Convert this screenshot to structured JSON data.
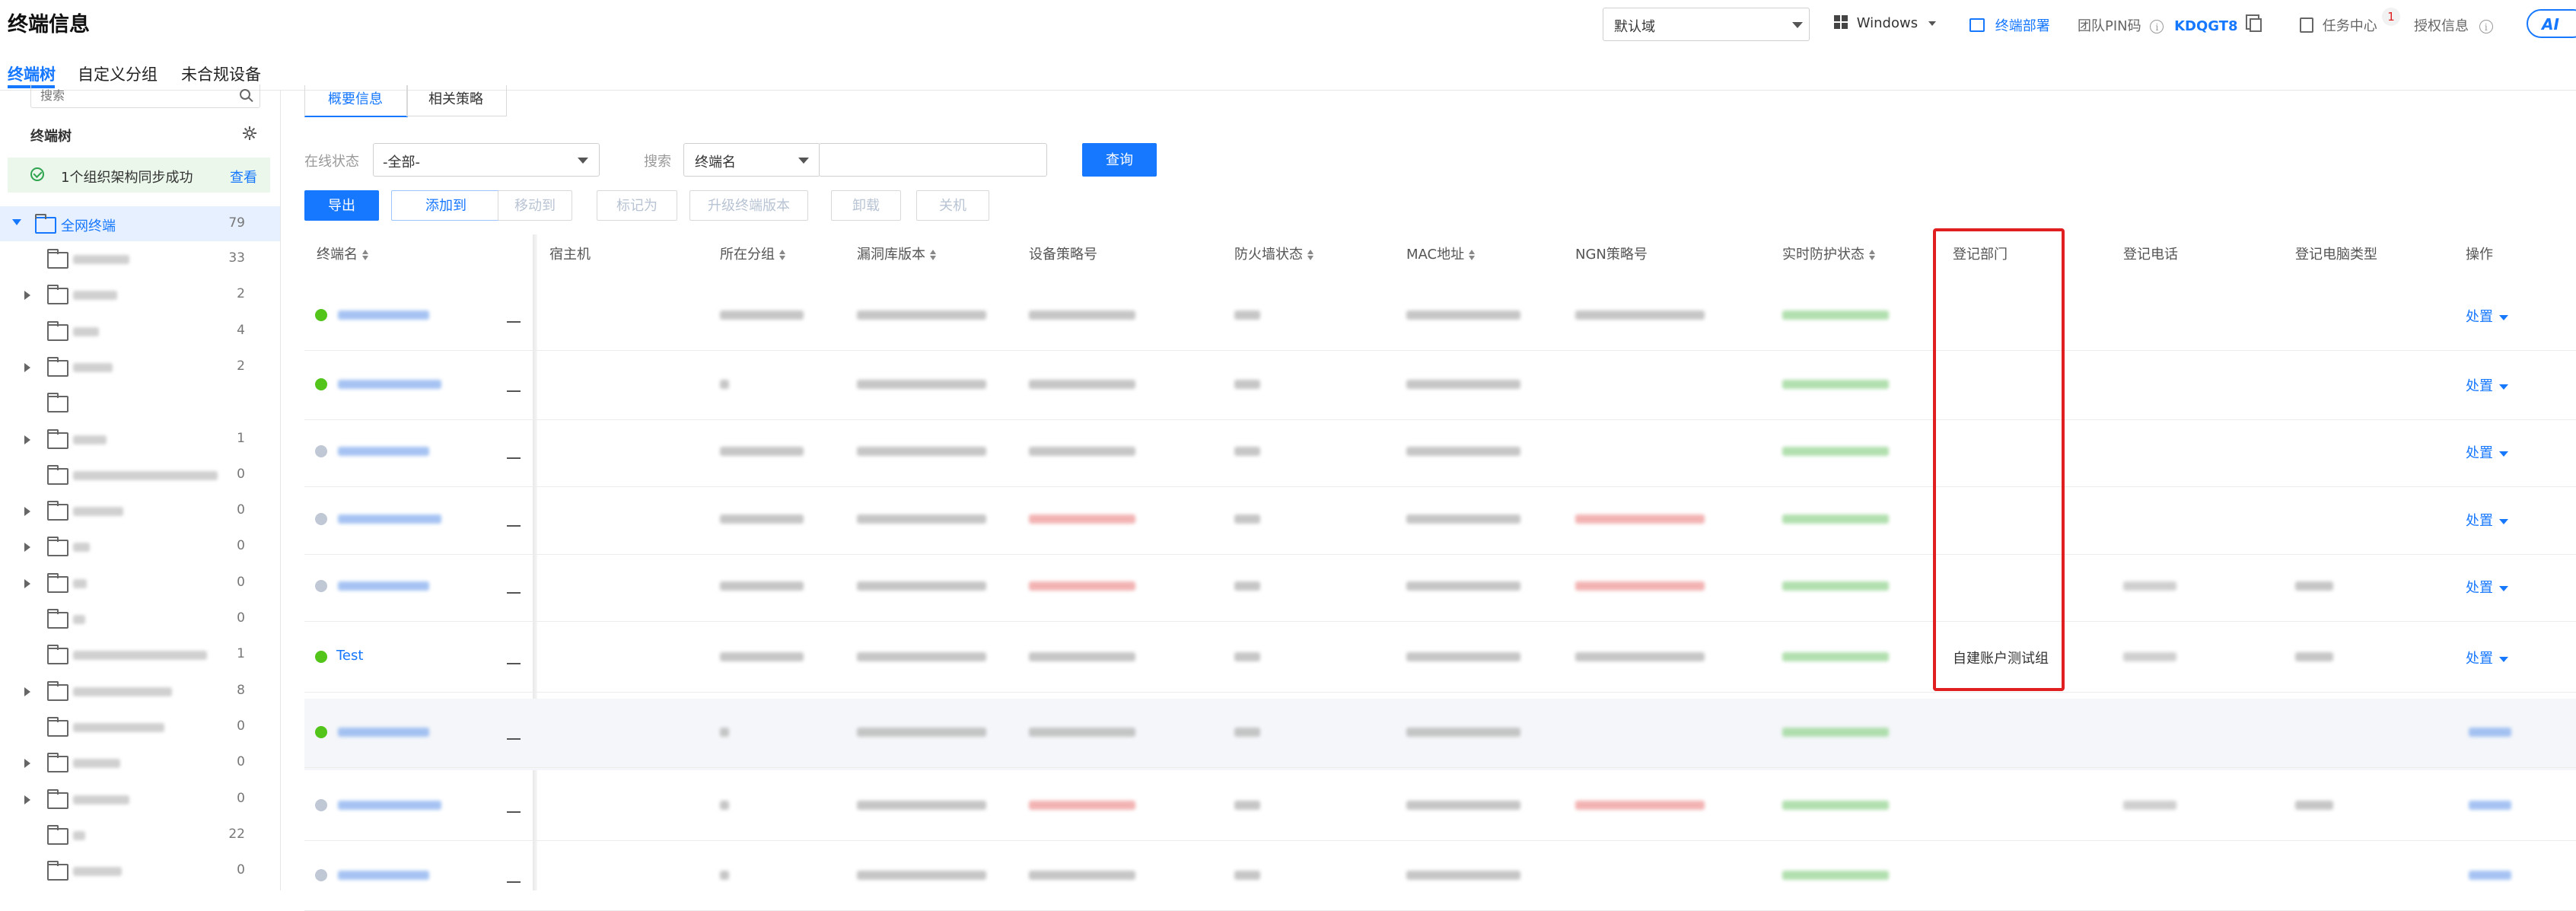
{
  "header": {
    "title": "终端信息",
    "domain_select": "默认域",
    "os_select": "Windows",
    "deploy_link": "终端部署",
    "pin_label": "团队PIN码",
    "pin_code": "KDQGT8",
    "task_center": "任务中心",
    "task_badge": "1",
    "license_info": "授权信息",
    "ai_label": "AI"
  },
  "nav": {
    "tabs": [
      "终端树",
      "自定义分组",
      "未合规设备"
    ]
  },
  "sidebar": {
    "search_placeholder": "搜索",
    "tree_title": "终端树",
    "sync_message": "1个组织架构同步成功",
    "sync_link": "查看",
    "root_label": "全网终端",
    "root_count": "79",
    "items": [
      {
        "count": "33"
      },
      {
        "count": "2"
      },
      {
        "count": "4"
      },
      {
        "count": "2"
      },
      {
        "count": ""
      },
      {
        "count": "1"
      },
      {
        "count": "0"
      },
      {
        "count": "0"
      },
      {
        "count": "0"
      },
      {
        "count": "0"
      },
      {
        "count": "0"
      },
      {
        "count": "1"
      },
      {
        "count": "8"
      },
      {
        "count": "0"
      },
      {
        "count": "0"
      },
      {
        "count": "0"
      },
      {
        "count": "22"
      },
      {
        "count": "0"
      }
    ]
  },
  "tabs": {
    "overview": "概要信息",
    "policy": "相关策略"
  },
  "filters": {
    "online_label": "在线状态",
    "online_value": "-全部-",
    "search_label": "搜索",
    "search_field": "终端名",
    "query_button": "查询"
  },
  "toolbar": {
    "export": "导出",
    "add_to": "添加到",
    "move_to": "移动到",
    "mark_as": "标记为",
    "upgrade": "升级终端版本",
    "uninstall": "卸载",
    "shutdown": "关机"
  },
  "table": {
    "headers": [
      "终端名",
      "宿主机",
      "所在分组",
      "漏洞库版本",
      "设备策略号",
      "防火墙状态",
      "MAC地址",
      "NGN策略号",
      "实时防护状态",
      "登记部门",
      "登记电话",
      "登记电脑类型",
      "操作"
    ],
    "visible_row": {
      "name": "Test",
      "department": "自建账户测试组"
    },
    "action_label": "处置"
  },
  "colors": {
    "accent": "#1677ff",
    "highlight_box": "#e02020",
    "online_green": "#52c41a",
    "sync_bg": "#eaf7ea"
  }
}
